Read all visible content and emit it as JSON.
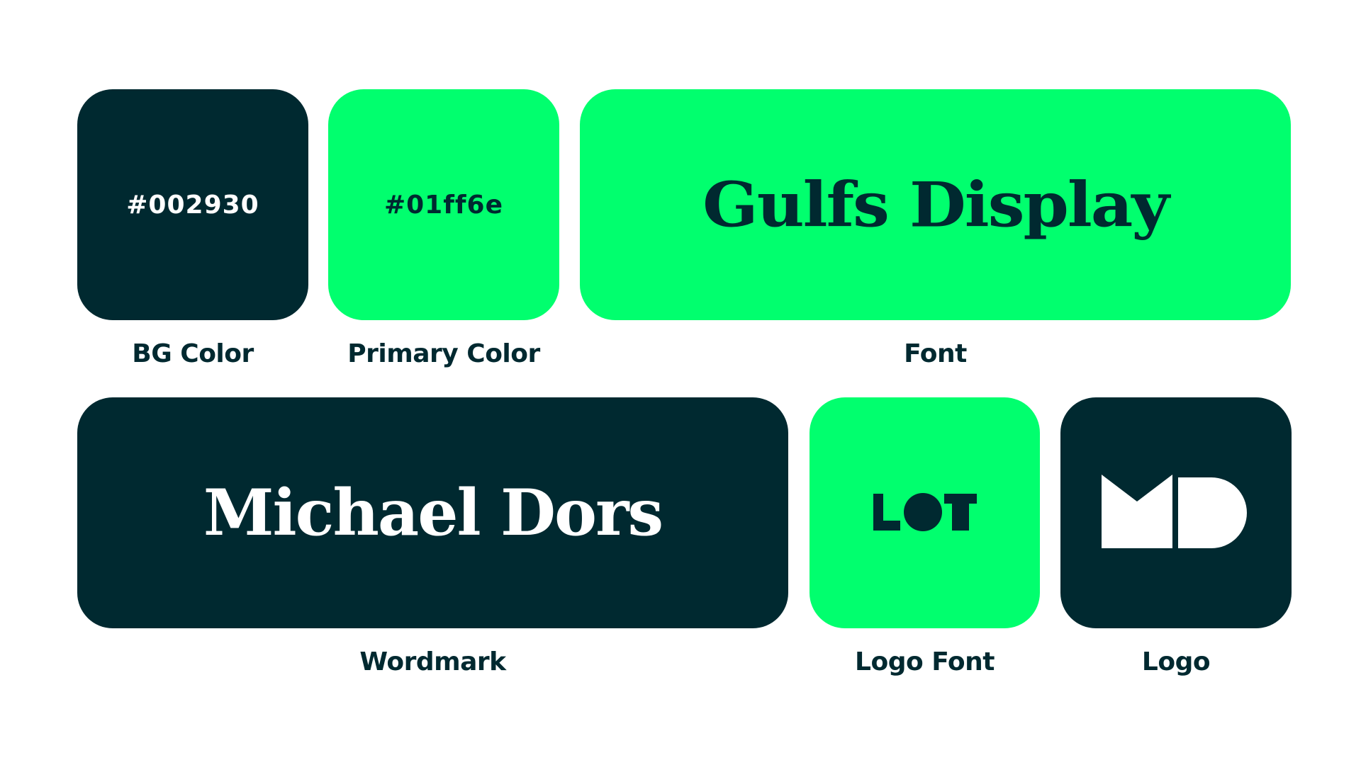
{
  "colors": {
    "bg": "#002930",
    "primary": "#01ff6e",
    "white": "#ffffff"
  },
  "tiles": {
    "bg_color": {
      "value": "#002930",
      "caption": "BG Color"
    },
    "primary_color": {
      "value": "#01ff6e",
      "caption": "Primary Color"
    },
    "font": {
      "sample": "Gulfs Display",
      "caption": "Font"
    },
    "wordmark": {
      "sample": "Michael Dors",
      "caption": "Wordmark"
    },
    "logo_font": {
      "sample": "LOT",
      "caption": "Logo Font"
    },
    "logo": {
      "sample": "MD",
      "caption": "Logo"
    }
  },
  "icons": {
    "logo_font": "lot-logo-icon",
    "logo": "md-monogram-icon"
  }
}
